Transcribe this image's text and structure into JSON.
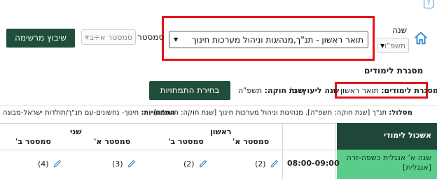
{
  "header": {
    "year_label": "שנה",
    "year_value": "תשפ\"ו",
    "program_value": "תואר ראשון - תנ\"ך,מנהיגות וניהול מערכות חינוך",
    "semester_label": "סמסטר",
    "semester_value": "סמסטר א+ב",
    "assign_button": "שיבוץ מרשימה"
  },
  "framework": {
    "section_title": "מסגרת לימודים",
    "framework_label": "מסגרת לימודים:",
    "framework_value": "תואר ראשון",
    "advise_year_label": "שנה ליעוץ:",
    "advise_year_value": "ב'",
    "law_year_label": "שנת חוקה:",
    "law_year_value": "תשפ\"ה",
    "specializations_button": "בחירת התמחויות"
  },
  "track": {
    "track_label": "מסלול:",
    "track_value": "תנ\"ך [שנת חוקה: תשפ\"ה]. מנהיגות וניהול מערכות חינוך [שנת חוקה: תשפ\"ה]",
    "specs_label": "התמחויות:",
    "specs_value": "חינוך- נחשונים-עם תנ\"ך/תולדות ישראל-מבונה"
  },
  "table": {
    "cluster_header": "אשכול לימודי",
    "year_first": "ראשון",
    "year_second": "שני",
    "sem_a": "סמסטר א'",
    "sem_b": "סמסטר ב'",
    "course_name": "שנה א' אנגלית כשפה-זרה [אנגלית]",
    "time_slot": "08:00-09:00",
    "counts": [
      "(2)",
      "(2)",
      "(3)",
      "(4)"
    ]
  },
  "colors": {
    "accent_dark_green": "#1f4e3b",
    "course_green": "#5bcc8a",
    "highlight_red": "#e3141b",
    "icon_blue": "#3a8fd0"
  },
  "icons": [
    "help-icon",
    "home-icon",
    "chevron-down-icon",
    "pencil-icon"
  ]
}
